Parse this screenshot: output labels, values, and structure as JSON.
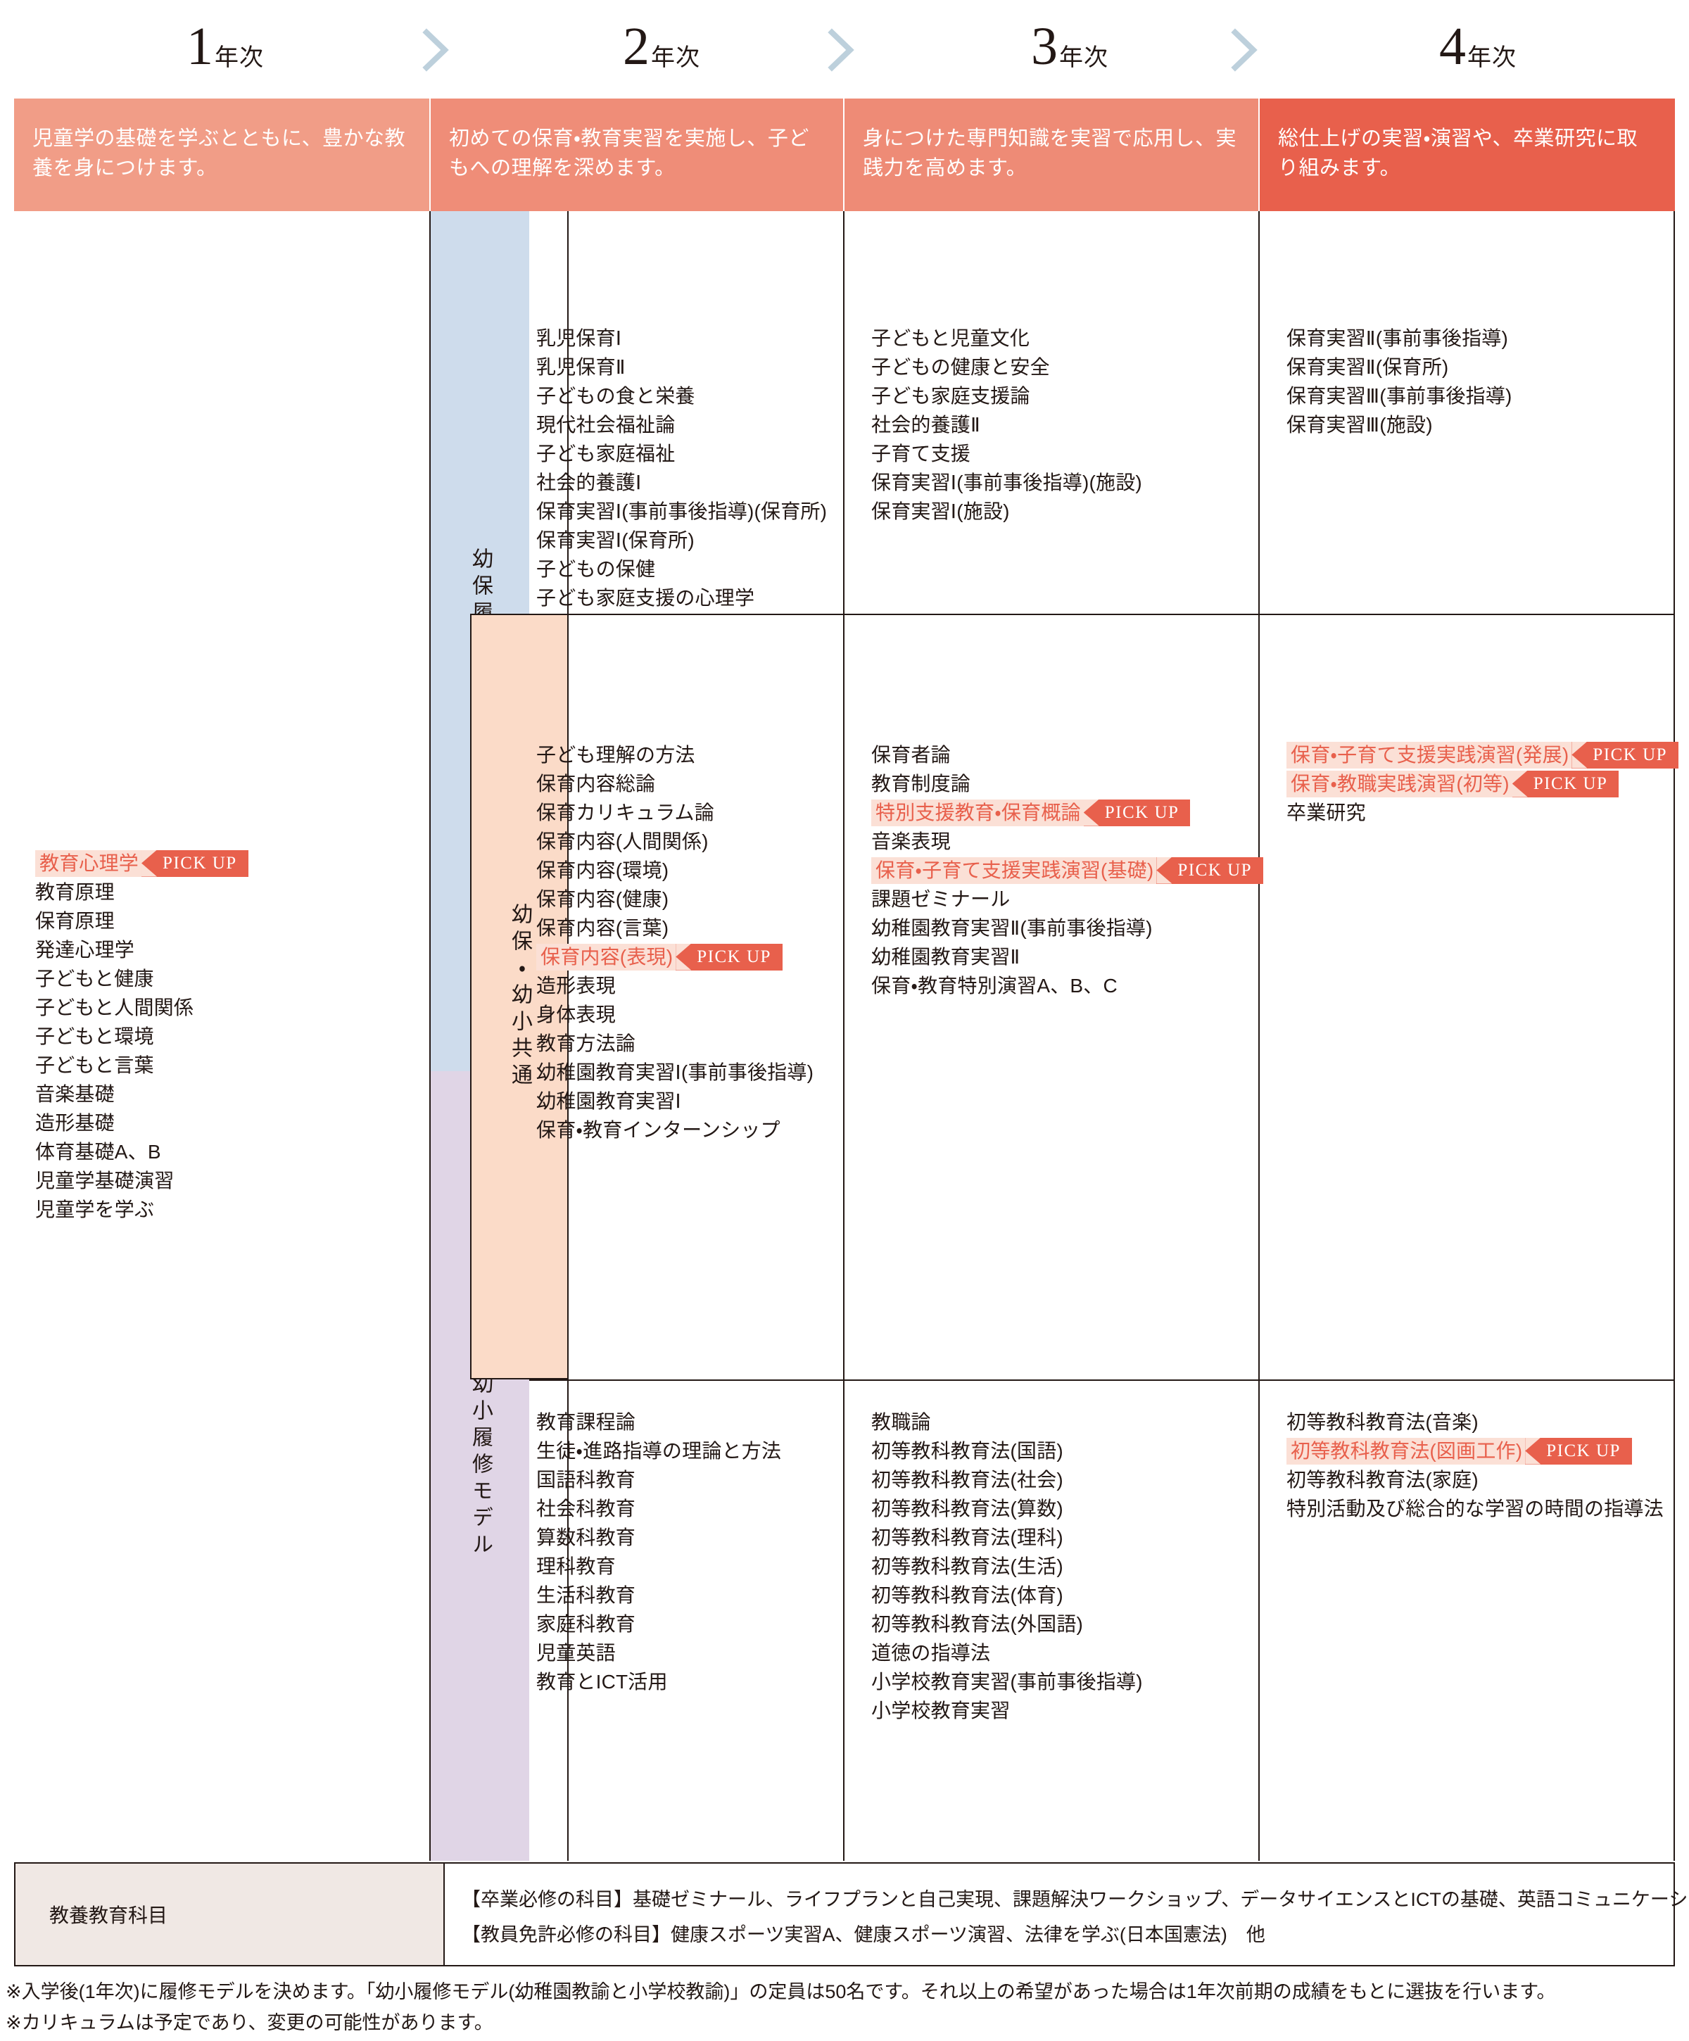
{
  "years": [
    {
      "num": "1",
      "suffix": "年次",
      "desc": "児童学の基礎を学ぶとともに、豊かな教養を身につけます。"
    },
    {
      "num": "2",
      "suffix": "年次",
      "desc": "初めての保育・教育実習を実施し、子どもへの理解を深めます。"
    },
    {
      "num": "3",
      "suffix": "年次",
      "desc": "身につけた専門知識を実習で応用し、実践力を高めます。"
    },
    {
      "num": "4",
      "suffix": "年次",
      "desc": "総仕上げの実習・演習や、卒業研究に取り組みます。"
    }
  ],
  "colors": {
    "desc_bg_1": "#f19d87",
    "desc_bg_2": "#ef8d78",
    "desc_bg_3": "#ee8b76",
    "desc_bg_4": "#e8604c",
    "band_yoho": "#cedcec",
    "band_kyotsu": "#fbdbc8",
    "band_yosho": "#e0d5e6",
    "pickup_bg": "#e8604c",
    "pickup_strip": "#fbe0d6",
    "pickup_text": "#e8604c",
    "chevron": "#bdd0dc",
    "gen_label_bg": "#f0e8e4",
    "ink": "#231815"
  },
  "bands": [
    {
      "id": "yoho",
      "label": "幼保履修モデル"
    },
    {
      "id": "kyotsu",
      "label": "幼保・幼小共通"
    },
    {
      "id": "yosho",
      "label": "幼小履修モデル"
    }
  ],
  "pickup_label": "PICK UP",
  "year1_courses": [
    {
      "name": "教育心理学",
      "pickup": true
    },
    {
      "name": "教育原理",
      "pickup": false
    },
    {
      "name": "保育原理",
      "pickup": false
    },
    {
      "name": "発達心理学",
      "pickup": false
    },
    {
      "name": "子どもと健康",
      "pickup": false
    },
    {
      "name": "子どもと人間関係",
      "pickup": false
    },
    {
      "name": "子どもと環境",
      "pickup": false
    },
    {
      "name": "子どもと言葉",
      "pickup": false
    },
    {
      "name": "音楽基礎",
      "pickup": false
    },
    {
      "name": "造形基礎",
      "pickup": false
    },
    {
      "name": "体育基礎A、B",
      "pickup": false
    },
    {
      "name": "児童学基礎演習",
      "pickup": false
    },
    {
      "name": "児童学を学ぶ",
      "pickup": false
    }
  ],
  "rows": [
    {
      "band": "幼保履修モデル",
      "year2": [
        {
          "name": "乳児保育Ⅰ",
          "pickup": false
        },
        {
          "name": "乳児保育Ⅱ",
          "pickup": false
        },
        {
          "name": "子どもの食と栄養",
          "pickup": false
        },
        {
          "name": "現代社会福祉論",
          "pickup": false
        },
        {
          "name": "子ども家庭福祉",
          "pickup": false
        },
        {
          "name": "社会的養護Ⅰ",
          "pickup": false
        },
        {
          "name": "保育実習Ⅰ(事前事後指導)(保育所)",
          "pickup": false
        },
        {
          "name": "保育実習Ⅰ(保育所)",
          "pickup": false
        },
        {
          "name": "子どもの保健",
          "pickup": false
        },
        {
          "name": "子ども家庭支援の心理学",
          "pickup": false
        }
      ],
      "year3": [
        {
          "name": "子どもと児童文化",
          "pickup": false
        },
        {
          "name": "子どもの健康と安全",
          "pickup": false
        },
        {
          "name": "子ども家庭支援論",
          "pickup": false
        },
        {
          "name": "社会的養護Ⅱ",
          "pickup": false
        },
        {
          "name": "子育て支援",
          "pickup": false
        },
        {
          "name": "保育実習Ⅰ(事前事後指導)(施設)",
          "pickup": false
        },
        {
          "name": "保育実習Ⅰ(施設)",
          "pickup": false
        }
      ],
      "year4": [
        {
          "name": "保育実習Ⅱ(事前事後指導)",
          "pickup": false
        },
        {
          "name": "保育実習Ⅱ(保育所)",
          "pickup": false
        },
        {
          "name": "保育実習Ⅲ(事前事後指導)",
          "pickup": false
        },
        {
          "name": "保育実習Ⅲ(施設)",
          "pickup": false
        }
      ]
    },
    {
      "band": "幼保・幼小共通",
      "year2": [
        {
          "name": "子ども理解の方法",
          "pickup": false
        },
        {
          "name": "保育内容総論",
          "pickup": false
        },
        {
          "name": "保育カリキュラム論",
          "pickup": false
        },
        {
          "name": "保育内容(人間関係)",
          "pickup": false
        },
        {
          "name": "保育内容(環境)",
          "pickup": false
        },
        {
          "name": "保育内容(健康)",
          "pickup": false
        },
        {
          "name": "保育内容(言葉)",
          "pickup": false
        },
        {
          "name": "保育内容(表現)",
          "pickup": true
        },
        {
          "name": "造形表現",
          "pickup": false
        },
        {
          "name": "身体表現",
          "pickup": false
        },
        {
          "name": "教育方法論",
          "pickup": false
        },
        {
          "name": "幼稚園教育実習Ⅰ(事前事後指導)",
          "pickup": false
        },
        {
          "name": "幼稚園教育実習Ⅰ",
          "pickup": false
        },
        {
          "name": "保育・教育インターンシップ",
          "pickup": false
        }
      ],
      "year3": [
        {
          "name": "保育者論",
          "pickup": false
        },
        {
          "name": "教育制度論",
          "pickup": false
        },
        {
          "name": "特別支援教育・保育概論",
          "pickup": true
        },
        {
          "name": "音楽表現",
          "pickup": false
        },
        {
          "name": "保育・子育て支援実践演習(基礎)",
          "pickup": true
        },
        {
          "name": "課題ゼミナール",
          "pickup": false
        },
        {
          "name": "幼稚園教育実習Ⅱ(事前事後指導)",
          "pickup": false
        },
        {
          "name": "幼稚園教育実習Ⅱ",
          "pickup": false
        },
        {
          "name": "保育・教育特別演習A、B、C",
          "pickup": false
        }
      ],
      "year4": [
        {
          "name": "保育・子育て支援実践演習(発展)",
          "pickup": true
        },
        {
          "name": "保育・教職実践演習(初等)",
          "pickup": true
        },
        {
          "name": "卒業研究",
          "pickup": false
        }
      ]
    },
    {
      "band": "幼小履修モデル",
      "year2": [
        {
          "name": "教育課程論",
          "pickup": false
        },
        {
          "name": "生徒・進路指導の理論と方法",
          "pickup": false
        },
        {
          "name": "国語科教育",
          "pickup": false
        },
        {
          "name": "社会科教育",
          "pickup": false
        },
        {
          "name": "算数科教育",
          "pickup": false
        },
        {
          "name": "理科教育",
          "pickup": false
        },
        {
          "name": "生活科教育",
          "pickup": false
        },
        {
          "name": "家庭科教育",
          "pickup": false
        },
        {
          "name": "児童英語",
          "pickup": false
        },
        {
          "name": "教育とICT活用",
          "pickup": false
        }
      ],
      "year3": [
        {
          "name": "教職論",
          "pickup": false
        },
        {
          "name": "初等教科教育法(国語)",
          "pickup": false
        },
        {
          "name": "初等教科教育法(社会)",
          "pickup": false
        },
        {
          "name": "初等教科教育法(算数)",
          "pickup": false
        },
        {
          "name": "初等教科教育法(理科)",
          "pickup": false
        },
        {
          "name": "初等教科教育法(生活)",
          "pickup": false
        },
        {
          "name": "初等教科教育法(体育)",
          "pickup": false
        },
        {
          "name": "初等教科教育法(外国語)",
          "pickup": false
        },
        {
          "name": "道徳の指導法",
          "pickup": false
        },
        {
          "name": "小学校教育実習(事前事後指導)",
          "pickup": false
        },
        {
          "name": "小学校教育実習",
          "pickup": false
        }
      ],
      "year4": [
        {
          "name": "初等教科教育法(音楽)",
          "pickup": false
        },
        {
          "name": "初等教科教育法(図画工作)",
          "pickup": true
        },
        {
          "name": "初等教科教育法(家庭)",
          "pickup": false
        },
        {
          "name": "特別活動及び総合的な学習の時間の指導法",
          "pickup": false
        }
      ]
    }
  ],
  "general_education": {
    "label": "教養教育科目",
    "lines": [
      "【卒業必修の科目】基礎ゼミナール、ライフプランと自己実現、課題解決ワークショップ、データサイエンスとICTの基礎、英語コミュニケーションⅠ・Ⅱ",
      "【教員免許必修の科目】健康スポーツ実習A、健康スポーツ演習、法律を学ぶ(日本国憲法)　他"
    ]
  },
  "notes": [
    "※入学後(1年次)に履修モデルを決めます。「幼小履修モデル(幼稚園教諭と小学校教諭)」の定員は50名です。それ以上の希望があった場合は1年次前期の成績をもとに選抜を行います。",
    "※カリキュラムは予定であり、変更の可能性があります。"
  ]
}
